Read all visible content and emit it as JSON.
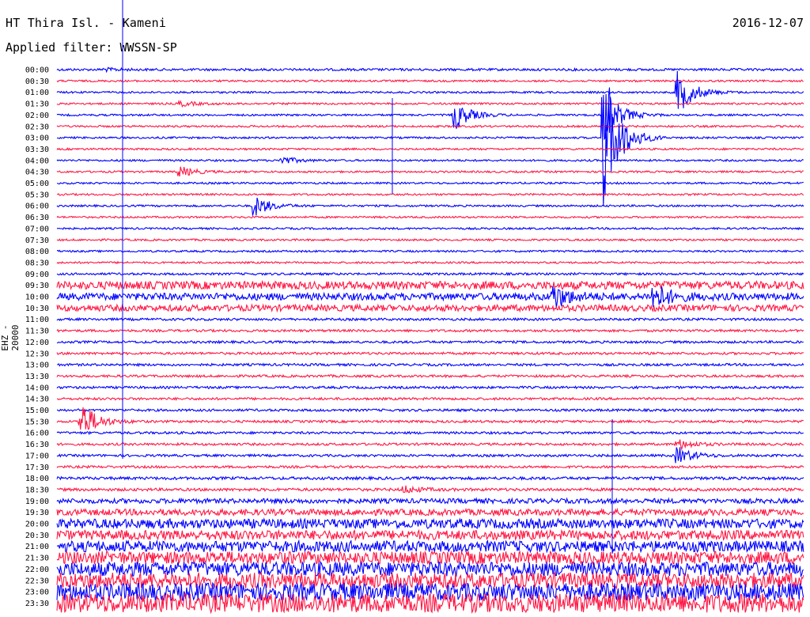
{
  "header": {
    "station": "HT Thira Isl. - Kameni",
    "date": "2016-12-07",
    "filter": "Applied filter: WWSSN-SP",
    "channel": "EHZ - 20000"
  },
  "chart_data": {
    "type": "line",
    "title": "HT Thira Isl. - Kameni",
    "ylabel": "EHZ - 20000",
    "time_labels": [
      "00:00",
      "00:30",
      "01:00",
      "01:30",
      "02:00",
      "02:30",
      "03:00",
      "03:30",
      "04:00",
      "04:30",
      "05:00",
      "05:30",
      "06:00",
      "06:30",
      "07:00",
      "07:30",
      "08:00",
      "08:30",
      "09:00",
      "09:30",
      "10:00",
      "10:30",
      "11:00",
      "11:30",
      "12:00",
      "12:30",
      "13:00",
      "13:30",
      "14:00",
      "14:30",
      "15:00",
      "15:30",
      "16:00",
      "16:30",
      "17:00",
      "17:30",
      "18:00",
      "18:30",
      "19:00",
      "19:30",
      "20:00",
      "20:30",
      "21:00",
      "21:30",
      "22:00",
      "22:30",
      "23:00",
      "23:30"
    ],
    "trace_colors": [
      "#0000ff",
      "#ff1744"
    ],
    "background_noise_by_row": [
      1.5,
      1.2,
      1.2,
      1.2,
      1.2,
      1.2,
      1.2,
      1.2,
      1.2,
      1.2,
      1.2,
      1.2,
      1.2,
      1.2,
      1.2,
      1.2,
      1.2,
      1.2,
      1.4,
      5,
      4.5,
      4,
      1.5,
      1.5,
      1.5,
      1.5,
      1.5,
      1.5,
      1.5,
      1.5,
      1.5,
      1.5,
      1.5,
      1.5,
      1.5,
      1.5,
      1.8,
      1.8,
      3,
      4,
      6,
      6,
      7,
      8,
      9,
      10,
      11,
      12
    ],
    "events": [
      {
        "row": 0,
        "minute": 2,
        "amplitude": 1.5
      },
      {
        "row": 3,
        "minute": 5,
        "amplitude": 3
      },
      {
        "row": 4,
        "minute": 16,
        "amplitude": 18
      },
      {
        "row": 4,
        "minute": 22,
        "amplitude": 35
      },
      {
        "row": 2,
        "minute": 25,
        "amplitude": 26
      },
      {
        "row": 6,
        "minute": 22,
        "amplitude": 90
      },
      {
        "row": 8,
        "minute": 9,
        "amplitude": 5
      },
      {
        "row": 12,
        "minute": 8,
        "amplitude": 12
      },
      {
        "row": 9,
        "minute": 5,
        "amplitude": 6
      },
      {
        "row": 20,
        "minute": 20,
        "amplitude": 14
      },
      {
        "row": 20,
        "minute": 24,
        "amplitude": 16
      },
      {
        "row": 31,
        "minute": 1,
        "amplitude": 24
      },
      {
        "row": 34,
        "minute": 25,
        "amplitude": 10
      },
      {
        "row": 33,
        "minute": 25,
        "amplitude": 6
      },
      {
        "row": 37,
        "minute": 14,
        "amplitude": 4
      }
    ]
  }
}
